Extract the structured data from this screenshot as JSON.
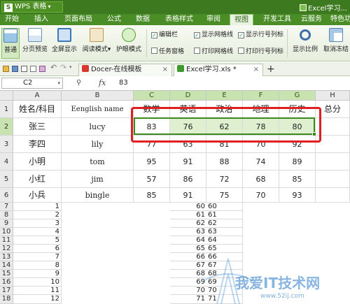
{
  "titlebar": {
    "app_name": "WPS 表格",
    "logo_letter": "S",
    "caret": "▾",
    "window_title": "Excel学习..."
  },
  "menu": {
    "items": [
      "开始",
      "插入",
      "页面布局",
      "公式",
      "数据",
      "表格样式",
      "审阅",
      "视图",
      "开发工具",
      "云服务",
      "特色功能"
    ],
    "active": "视图"
  },
  "ribbon": {
    "buttons": [
      {
        "label": "普通",
        "icon": "normal-view-icon",
        "active": true
      },
      {
        "label": "分页预览",
        "icon": "page-break-preview-icon",
        "active": false
      },
      {
        "label": "全屏显示",
        "icon": "fullscreen-icon",
        "active": false
      },
      {
        "label": "阅读模式",
        "icon": "reading-mode-icon",
        "caret": "▾",
        "active": false
      },
      {
        "label": "护眼模式",
        "icon": "eye-care-icon",
        "active": false
      },
      {
        "label": "显示比例",
        "icon": "zoom-icon",
        "active": false
      },
      {
        "label": "取消冻结",
        "icon": "freeze-panes-icon",
        "active": false
      }
    ],
    "checkboxes": [
      {
        "label": "编辑栏",
        "checked": true
      },
      {
        "label": "任务窗格",
        "checked": false
      },
      {
        "label": "显示网格线",
        "checked": true
      },
      {
        "label": "打印网格线",
        "checked": false
      },
      {
        "label": "显示行号列标",
        "checked": true
      },
      {
        "label": "打印行号列标",
        "checked": false
      }
    ]
  },
  "tabs": [
    {
      "label": "Docer-在线模板",
      "close": "×",
      "active": false
    },
    {
      "label": "Excel学习.xls *",
      "close": "×",
      "active": true
    }
  ],
  "new_tab": "+",
  "formula_bar": {
    "cell_ref": "C2",
    "dropdown": "▾",
    "zoom_icon": "⚲",
    "fx": "fx",
    "value": "83"
  },
  "colors": {
    "accent": "#3c8a1e",
    "menubar": "#4a8c26",
    "highlight": "#e02020"
  },
  "sheet": {
    "columns": [
      "A",
      "B",
      "C",
      "D",
      "E",
      "F",
      "G",
      "H"
    ],
    "selected_columns": [
      "C",
      "D",
      "E",
      "F",
      "G"
    ],
    "row_numbers": [
      "1",
      "2",
      "3",
      "4",
      "5",
      "6",
      "7",
      "8",
      "9",
      "10",
      "11",
      "12",
      "13",
      "14",
      "15",
      "16",
      "17",
      "18"
    ],
    "selected_row": "2",
    "header_row": [
      "姓名/科目",
      "Eenglish name",
      "数学",
      "英语",
      "政治",
      "地理",
      "历史",
      "总分"
    ],
    "students": [
      {
        "name": "张三",
        "english": "lucy",
        "scores": [
          "83",
          "76",
          "62",
          "78",
          "80"
        ]
      },
      {
        "name": "李四",
        "english": "lily",
        "scores": [
          "77",
          "63",
          "81",
          "70",
          "92"
        ]
      },
      {
        "name": "小明",
        "english": "tom",
        "scores": [
          "95",
          "91",
          "88",
          "74",
          "89"
        ]
      },
      {
        "name": "小红",
        "english": "jim",
        "scores": [
          "57",
          "86",
          "72",
          "68",
          "85"
        ]
      },
      {
        "name": "小兵",
        "english": "bingle",
        "scores": [
          "85",
          "91",
          "75",
          "70",
          "93"
        ]
      }
    ],
    "number_rows": [
      {
        "a": "1",
        "c": "60",
        "d": "60"
      },
      {
        "a": "2",
        "c": "61",
        "d": "61"
      },
      {
        "a": "3",
        "c": "62",
        "d": "62"
      },
      {
        "a": "4",
        "c": "63",
        "d": "63"
      },
      {
        "a": "5",
        "c": "64",
        "d": "64"
      },
      {
        "a": "6",
        "c": "65",
        "d": "65"
      },
      {
        "a": "7",
        "c": "66",
        "d": "66"
      },
      {
        "a": "8",
        "c": "67",
        "d": "67"
      },
      {
        "a": "9",
        "c": "68",
        "d": "68"
      },
      {
        "a": "10",
        "c": "69",
        "d": "69"
      },
      {
        "a": "11",
        "c": "70",
        "d": "70"
      },
      {
        "a": "12",
        "c": "71",
        "d": "71"
      }
    ]
  },
  "watermark": {
    "text": "我爱IT技术网",
    "url": "www.52ij.com"
  }
}
